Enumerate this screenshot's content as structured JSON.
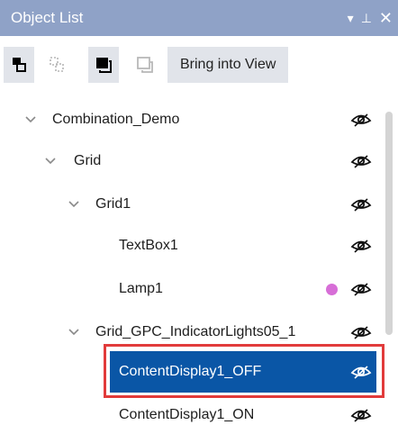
{
  "panel": {
    "title": "Object List",
    "controls": {
      "dropdown_icon": "▾",
      "pin_icon": "⊥",
      "close_icon": "✕"
    }
  },
  "toolbar": {
    "bring_into_view_label": "Bring into View"
  },
  "tree": {
    "items": [
      {
        "label": "Combination_Demo",
        "expanded": true,
        "visible": true
      },
      {
        "label": "Grid",
        "expanded": true,
        "visible": true
      },
      {
        "label": "Grid1",
        "expanded": true,
        "visible": true
      },
      {
        "label": "TextBox1",
        "visible": true
      },
      {
        "label": "Lamp1",
        "visible": true,
        "marker_color": "#d76ed7"
      },
      {
        "label": "Grid_GPC_IndicatorLights05_1",
        "expanded": true,
        "visible": true
      },
      {
        "label": "ContentDisplay1_OFF",
        "visible": true,
        "selected": true
      },
      {
        "label": "ContentDisplay1_ON",
        "visible": true
      }
    ]
  },
  "colors": {
    "titlebar_bg": "#8fa2c7",
    "selection_bg": "#0a56a6",
    "highlight_border": "#e13b3b"
  }
}
